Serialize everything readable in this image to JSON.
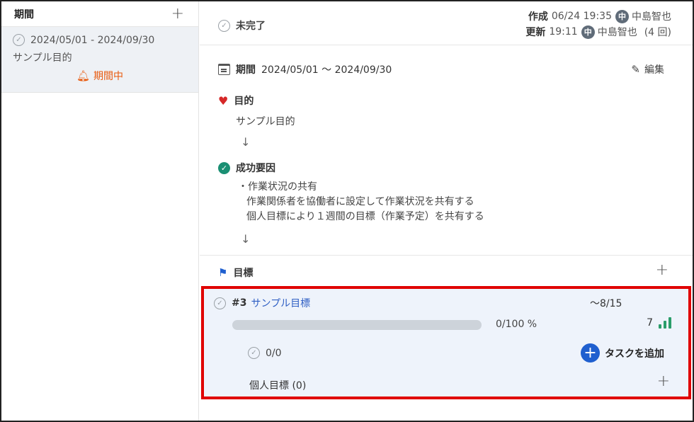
{
  "left": {
    "title": "期間",
    "add_icon": "plus-icon",
    "period": {
      "dates": "2024/05/01 - 2024/09/30",
      "purpose": "サンプル目的",
      "status": "期間中",
      "status_color": "#e8590c"
    }
  },
  "top": {
    "status": "未完了",
    "created_label": "作成",
    "created_time": "06/24 19:35",
    "created_avatar": "中",
    "created_user": "中島智也",
    "updated_label": "更新",
    "updated_time": "19:11",
    "updated_avatar": "中",
    "updated_user": "中島智也",
    "update_count": "(4 回)"
  },
  "detail": {
    "period_label": "期間",
    "period_value": "2024/05/01 〜 2024/09/30",
    "edit_label": "編集",
    "purpose_label": "目的",
    "purpose_value": "サンプル目的",
    "factors_label": "成功要因",
    "factors": [
      "・作業状況の共有",
      "作業関係者を協働者に設定して作業状況を共有する",
      "個人目標により１週間の目標（作業予定）を共有する"
    ]
  },
  "goals": {
    "title": "目標",
    "items": [
      {
        "number": "#3",
        "name": "サンプル目標",
        "due": "〜8/15",
        "progress": 0,
        "progress_text": "0/100 %",
        "level": "7",
        "tasks": "0/0",
        "add_task_label": "タスクを追加",
        "personal_label": "個人目標 (0)"
      }
    ]
  },
  "colors": {
    "accent": "#1f5fcf",
    "highlight_border": "#e00000",
    "success": "#1a8f73",
    "heart": "#d62828"
  }
}
